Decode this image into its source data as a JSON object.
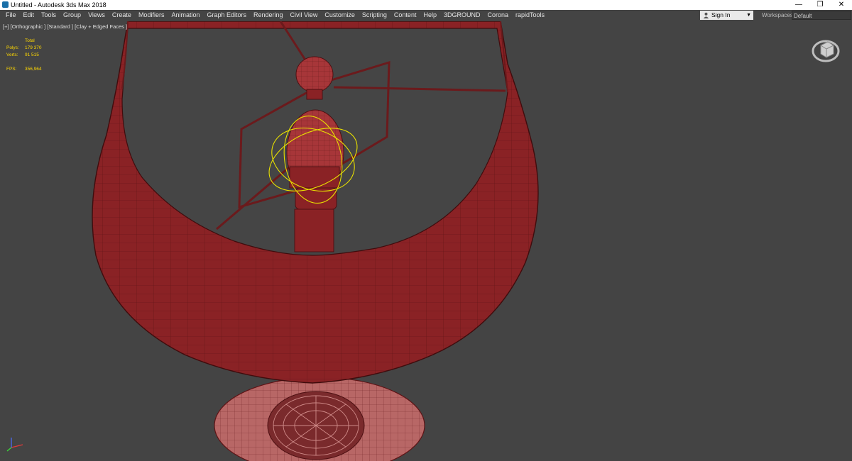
{
  "window": {
    "title": "Untitled - Autodesk 3ds Max 2018",
    "controls": {
      "minimize": "—",
      "restore": "❐",
      "close": "✕"
    }
  },
  "menu": [
    "File",
    "Edit",
    "Tools",
    "Group",
    "Views",
    "Create",
    "Modifiers",
    "Animation",
    "Graph Editors",
    "Rendering",
    "Civil View",
    "Customize",
    "Scripting",
    "Content",
    "Help",
    "3DGROUND",
    "Corona",
    "rapidTools"
  ],
  "account": {
    "sign_in_label": "Sign In"
  },
  "workspaces": {
    "label": "Workspaces:",
    "value": "Default"
  },
  "viewport": {
    "label": "[+] [Orthographic ] [Standard ] [Clay + Edged Faces ]",
    "stats": {
      "header": "Total",
      "polys_label": "Polys:",
      "polys_value": "179 370",
      "verts_label": "Verts:",
      "verts_value": "91 515",
      "fps_label": "FPS:",
      "fps_value": "356,964"
    }
  },
  "colors": {
    "viewport_bg": "#444444",
    "model_clay": "#8a2225",
    "selection_gizmo": "#e8e000",
    "stats_text": "#ffd800"
  },
  "icons": [
    "app-icon",
    "user-icon",
    "chevron-down-icon",
    "viewcube-icon",
    "axis-tripod-icon"
  ]
}
